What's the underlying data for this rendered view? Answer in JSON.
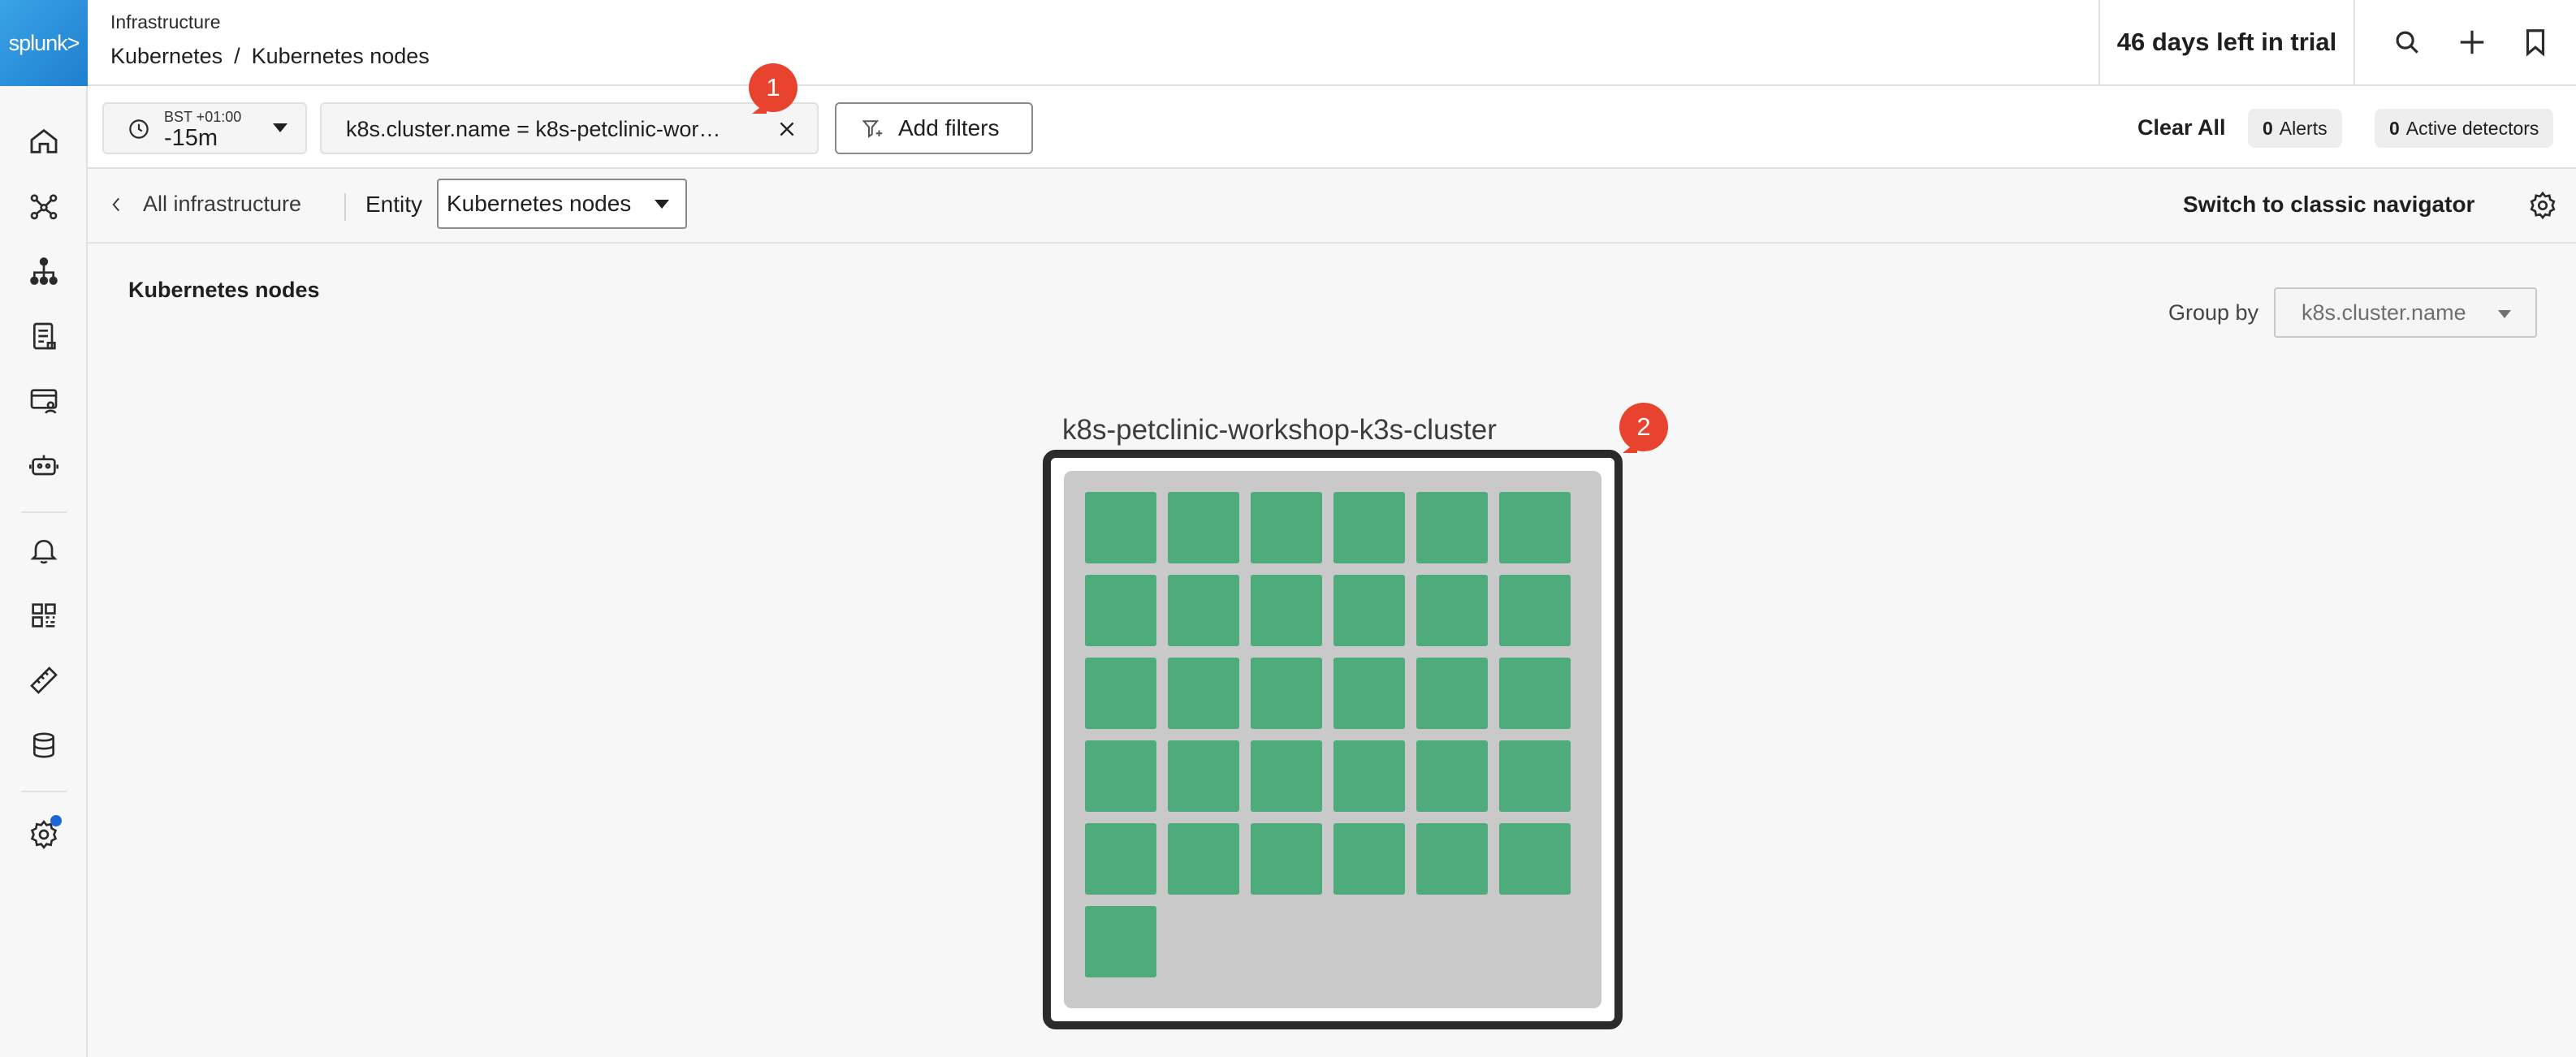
{
  "app": {
    "logo_text": "splunk>"
  },
  "header": {
    "section": "Infrastructure",
    "breadcrumb": [
      "Kubernetes",
      "/",
      "Kubernetes nodes"
    ],
    "trial_text": "46 days left in trial"
  },
  "filterbar": {
    "time": {
      "timezone": "BST +01:00",
      "value": "-15m"
    },
    "filter_chip": "k8s.cluster.name = k8s-petclinic-wor…",
    "add_filters_label": "Add filters",
    "clear_all_label": "Clear All",
    "alerts": {
      "count": "0",
      "label": "Alerts"
    },
    "detectors": {
      "count": "0",
      "label": "Active detectors"
    }
  },
  "subbar": {
    "back_label": "All infrastructure",
    "entity_label": "Entity",
    "entity_value": "Kubernetes nodes",
    "switch_label": "Switch to classic navigator"
  },
  "main": {
    "title": "Kubernetes nodes",
    "group_by_label": "Group by",
    "group_by_value": "k8s.cluster.name",
    "cluster": {
      "name": "k8s-petclinic-workshop-k3s-cluster",
      "node_count": 31,
      "node_color": "#4dab7c"
    }
  },
  "badges": [
    "1",
    "2"
  ],
  "colors": {
    "accent": "#1e7fd0",
    "badge": "#e8432e",
    "healthy": "#4dab7c"
  }
}
